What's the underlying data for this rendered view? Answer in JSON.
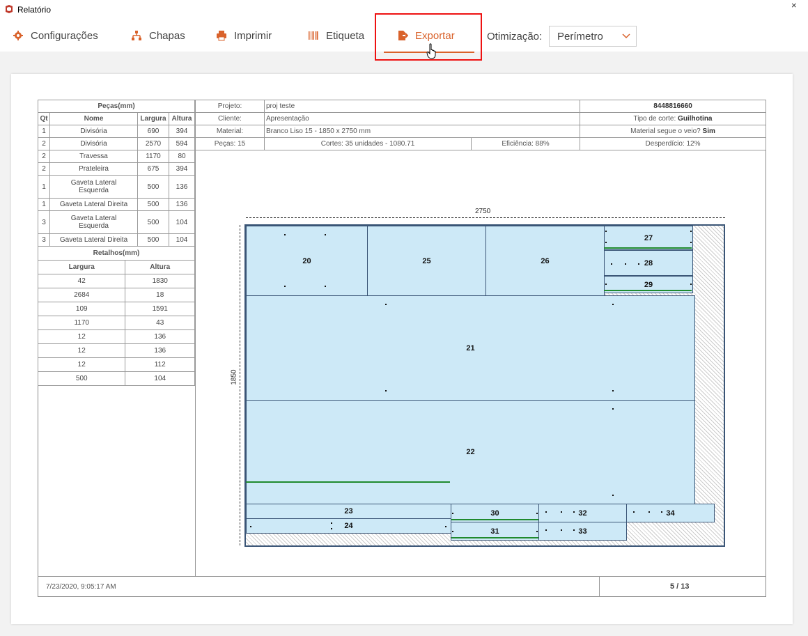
{
  "window": {
    "title": "Relatório",
    "close_glyph": "×"
  },
  "toolbar": {
    "items": [
      {
        "label": "Configurações",
        "icon": "gear-icon"
      },
      {
        "label": "Chapas",
        "icon": "sitemap-icon"
      },
      {
        "label": "Imprimir",
        "icon": "printer-icon"
      },
      {
        "label": "Etiqueta",
        "icon": "barcode-icon"
      },
      {
        "label": "Exportar",
        "icon": "export-icon",
        "active": true
      }
    ],
    "optimization_label": "Otimização:",
    "optimization_value": "Perímetro",
    "accent_color": "#d9622b",
    "highlight_color": "#e11111"
  },
  "pecas": {
    "title": "Peças(mm)",
    "headers": [
      "Qt",
      "Nome",
      "Largura",
      "Altura"
    ],
    "rows": [
      [
        "1",
        "Divisória",
        "690",
        "394"
      ],
      [
        "2",
        "Divisória",
        "2570",
        "594"
      ],
      [
        "2",
        "Travessa",
        "1170",
        "80"
      ],
      [
        "2",
        "Prateleira",
        "675",
        "394"
      ],
      [
        "1",
        "Gaveta Lateral Esquerda",
        "500",
        "136"
      ],
      [
        "1",
        "Gaveta Lateral Direita",
        "500",
        "136"
      ],
      [
        "3",
        "Gaveta Lateral Esquerda",
        "500",
        "104"
      ],
      [
        "3",
        "Gaveta Lateral Direita",
        "500",
        "104"
      ]
    ]
  },
  "retalhos": {
    "title": "Retalhos(mm)",
    "headers": [
      "Largura",
      "Altura"
    ],
    "rows": [
      [
        "42",
        "1830"
      ],
      [
        "2684",
        "18"
      ],
      [
        "109",
        "1591"
      ],
      [
        "1170",
        "43"
      ],
      [
        "12",
        "136"
      ],
      [
        "12",
        "136"
      ],
      [
        "12",
        "112"
      ],
      [
        "500",
        "104"
      ]
    ]
  },
  "info": {
    "projeto_label": "Projeto:",
    "projeto": "proj teste",
    "cliente_label": "Cliente:",
    "cliente": "Apresentação",
    "material_label": "Material:",
    "material": "Branco Liso 15 - 1850 x 2750 mm",
    "pecas": "Peças: 15",
    "cortes": "Cortes: 35 unidades - 1080.71",
    "eficiencia": "Eficiência: 88%",
    "codigo": "8448816660",
    "tipo_corte_label": "Tipo de corte:",
    "tipo_corte": "Guilhotina",
    "veio_label": "Material segue o veio?",
    "veio": "Sim",
    "desperdicio": "Desperdício: 12%"
  },
  "sheet": {
    "width_label": "2750",
    "height_label": "1850",
    "pieces": [
      {
        "id": "20"
      },
      {
        "id": "25"
      },
      {
        "id": "26"
      },
      {
        "id": "27"
      },
      {
        "id": "28"
      },
      {
        "id": "29"
      },
      {
        "id": "21"
      },
      {
        "id": "22"
      },
      {
        "id": "23"
      },
      {
        "id": "24"
      },
      {
        "id": "30"
      },
      {
        "id": "31"
      },
      {
        "id": "32"
      },
      {
        "id": "33"
      },
      {
        "id": "34"
      }
    ]
  },
  "footer": {
    "date": "7/23/2020, 9:05:17 AM",
    "page": "5 / 13"
  }
}
